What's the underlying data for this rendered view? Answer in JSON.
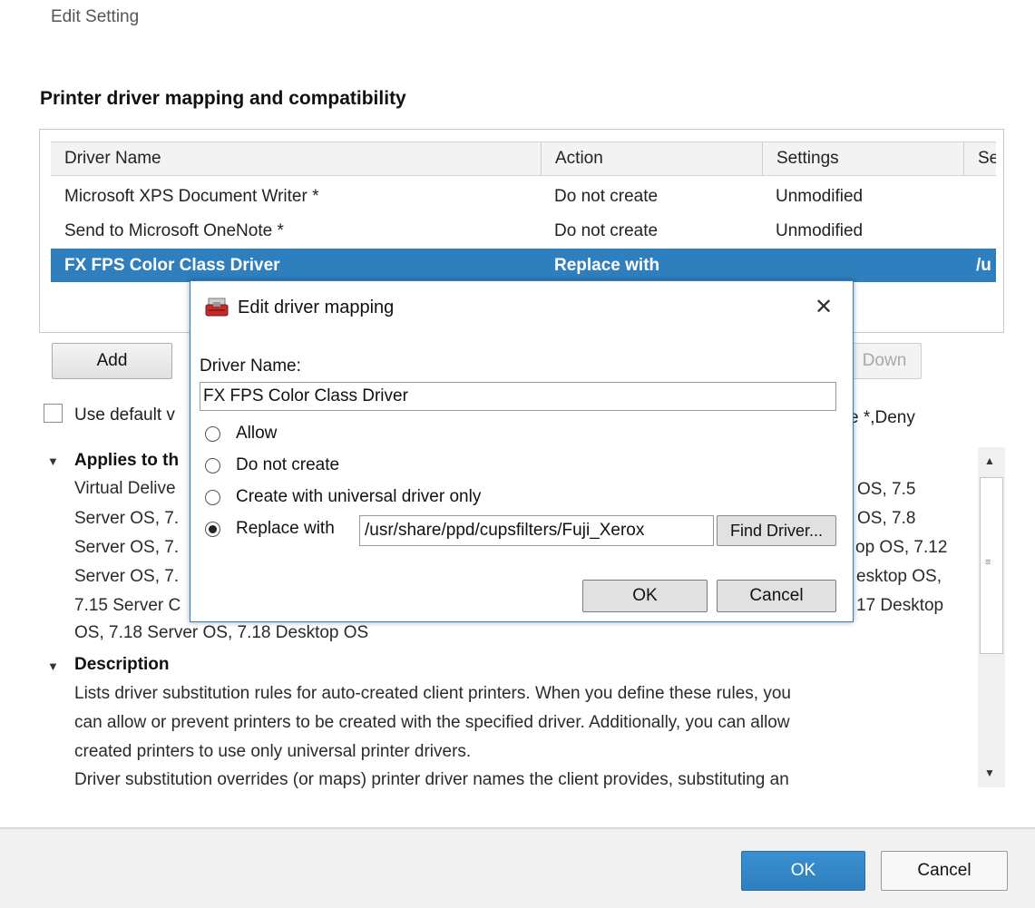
{
  "window": {
    "title": "Edit Setting"
  },
  "section": {
    "title": "Printer driver mapping and compatibility"
  },
  "table": {
    "headers": [
      "Driver Name",
      "Action",
      "Settings",
      "Se"
    ],
    "rows": [
      {
        "driver": "Microsoft XPS Document Writer *",
        "action": "Do not create",
        "settings": "Unmodified",
        "extra": ""
      },
      {
        "driver": "Send to Microsoft OneNote *",
        "action": "Do not create",
        "settings": "Unmodified",
        "extra": ""
      },
      {
        "driver": "FX FPS Color Class Driver",
        "action": "Replace with",
        "settings": "",
        "extra": "/u"
      }
    ],
    "selected_row": 2
  },
  "toolbar": {
    "add_label": "Add",
    "down_label": "Down"
  },
  "use_default": {
    "label": "Use default v",
    "trailing": "e *,Deny",
    "checked": false
  },
  "applies_to": {
    "heading": "Applies to th",
    "lines": [
      "Virtual Delive",
      "Server OS, 7.",
      "Server OS, 7.",
      "Server OS, 7.",
      "7.15 Server C",
      "OS, 7.18 Server OS, 7.18 Desktop OS"
    ],
    "right_lines": [
      "OS, 7.5",
      "OS, 7.8",
      "op OS, 7.12",
      "esktop OS,",
      "17 Desktop"
    ]
  },
  "description": {
    "heading": "Description",
    "lines": [
      "Lists driver substitution rules for auto-created client printers. When you define these rules, you",
      "can allow or prevent printers to be created with the specified driver. Additionally, you can allow",
      "created printers to use only universal printer drivers.",
      "Driver substitution overrides (or maps) printer driver names the client provides, substituting an"
    ]
  },
  "footer": {
    "ok_label": "OK",
    "cancel_label": "Cancel"
  },
  "dialog": {
    "title": "Edit driver mapping",
    "close_glyph": "✕",
    "driver_name_label": "Driver Name:",
    "driver_name_value": "FX FPS Color Class Driver",
    "options": [
      {
        "label": "Allow",
        "checked": false
      },
      {
        "label": "Do not create",
        "checked": false
      },
      {
        "label": "Create with universal driver only",
        "checked": false
      },
      {
        "label": "Replace with",
        "checked": true
      }
    ],
    "replace_path": "/usr/share/ppd/cupsfilters/Fuji_Xerox",
    "find_driver_label": "Find Driver...",
    "ok_label": "OK",
    "cancel_label": "Cancel"
  },
  "colors": {
    "accent": "#2f7fbe",
    "dialog_border": "#2a7fc8",
    "footer_bg": "#f1f1f1"
  },
  "icons": {
    "dialog_icon": "printer-toolbox-icon",
    "close": "close-icon",
    "collapse": "triangle-down-icon"
  }
}
